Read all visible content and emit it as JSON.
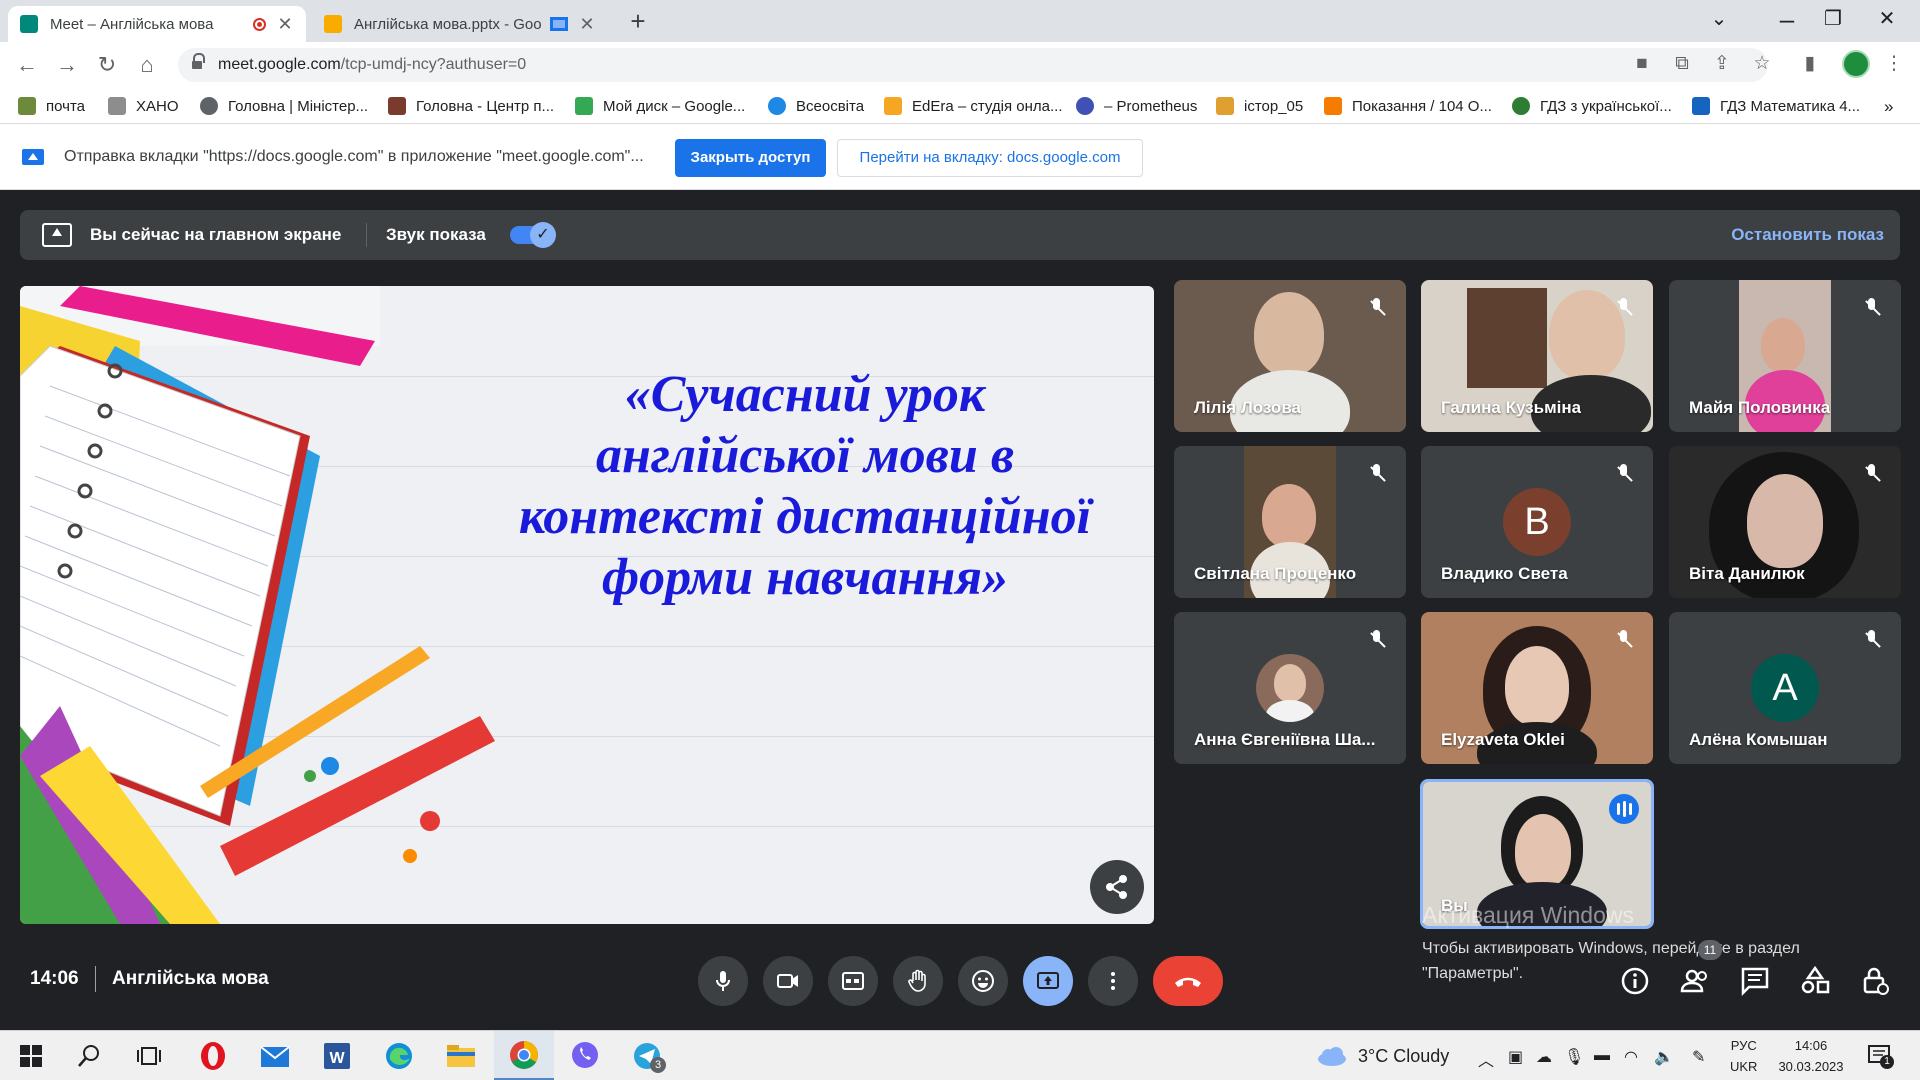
{
  "browser": {
    "tabs": [
      {
        "title": "Meet – Англійська мова",
        "favicon_color": "#00897b",
        "active": true
      },
      {
        "title": "Англійська мова.pptx - Goo",
        "favicon_color": "#f9ab00",
        "active": false
      }
    ],
    "url_host": "meet.google.com",
    "url_path": "/tcp-umdj-ncy?authuser=0"
  },
  "bookmarks": [
    {
      "label": "почта",
      "color": "#6d8a3c"
    },
    {
      "label": "ХАНО",
      "color": "#8d8d8d"
    },
    {
      "label": "Головна | Міністер...",
      "color": "#5f6368"
    },
    {
      "label": "Головна - Центр п...",
      "color": "#7a3b2e"
    },
    {
      "label": "Мой диск – Google...",
      "color": "#34a853"
    },
    {
      "label": "Всеосвіта",
      "color": "#1e88e5"
    },
    {
      "label": "EdEra – студія онла...",
      "color": "#f5a623"
    },
    {
      "label": "– Prometheus",
      "color": "#3f51b5"
    },
    {
      "label": "істор_05",
      "color": "#e0a030"
    },
    {
      "label": "Показання / 104 О...",
      "color": "#f57c00"
    },
    {
      "label": "ГДЗ з української...",
      "color": "#2e7d32"
    },
    {
      "label": "ГДЗ Математика 4...",
      "color": "#1565c0"
    }
  ],
  "bookmarks_more": "»",
  "infobar": {
    "message": "Отправка вкладки \"https://docs.google.com\" в приложение \"meet.google.com\"...",
    "stop_button": "Закрыть доступ",
    "goto_button": "Перейти на вкладку: docs.google.com"
  },
  "presenting": {
    "status": "Вы сейчас на главном экране",
    "sound_label": "Звук показа",
    "sound_on": true,
    "stop_label": "Остановить показ"
  },
  "slide": {
    "title_lines": [
      "«Сучасний урок",
      "англійської мови в",
      "контексті дистанційної",
      "форми навчання»"
    ]
  },
  "participants": [
    {
      "name": "Лілія Лозова",
      "type": "video",
      "muted": true,
      "bg": "#6b5a4e"
    },
    {
      "name": "Галина Кузьміна",
      "type": "video",
      "muted": true,
      "bg": "#d8d2c8"
    },
    {
      "name": "Майя Половинка",
      "type": "video",
      "muted": true,
      "bg": "#c8b8b0"
    },
    {
      "name": "Світлана Проценко",
      "type": "video",
      "muted": true,
      "bg": "#5c4a38"
    },
    {
      "name": "Владико Света",
      "type": "avatar",
      "initial": "В",
      "muted": true,
      "avatar_color": "#7b3f2e"
    },
    {
      "name": "Віта Данилюк",
      "type": "video",
      "muted": true,
      "bg": "#2a2a2a"
    },
    {
      "name": "Анна Євгеніївна Ша...",
      "type": "photo",
      "muted": true,
      "bg": "#3c4043"
    },
    {
      "name": "Elyzaveta Oklei",
      "type": "video",
      "muted": true,
      "bg": "#b08060"
    },
    {
      "name": "Алёна Комышан",
      "type": "avatar",
      "initial": "А",
      "muted": true,
      "avatar_color": "#00584f"
    }
  ],
  "self_tile": {
    "name": "Вы",
    "speaking": true
  },
  "windows_watermark": {
    "title": "Активация Windows",
    "body": "Чтобы активировать Windows, перейдите в раздел \"Параметры\"."
  },
  "meeting": {
    "time": "14:06",
    "name": "Англійська мова",
    "notification_count": "11"
  },
  "taskbar": {
    "chat_badge": "3",
    "weather": "3°C  Cloudy",
    "lang_top": "РУС",
    "lang_bottom": "UKR",
    "time": "14:06",
    "date": "30.03.2023",
    "notification_count": "1"
  }
}
